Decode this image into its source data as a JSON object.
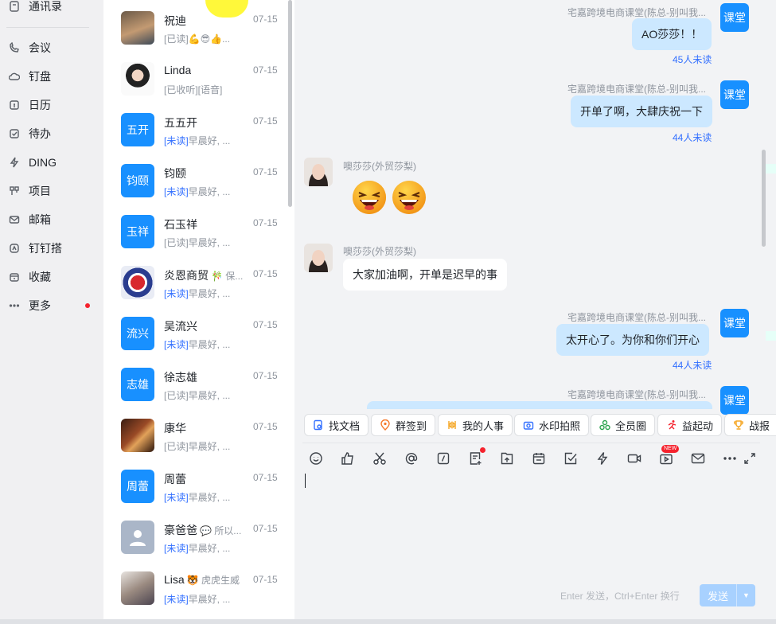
{
  "nav": {
    "items": [
      {
        "label": "通讯录",
        "icon": "contacts-icon"
      },
      {
        "label": "会议",
        "icon": "meeting-icon"
      },
      {
        "label": "钉盘",
        "icon": "cloud-drive-icon"
      },
      {
        "label": "日历",
        "icon": "calendar-icon"
      },
      {
        "label": "待办",
        "icon": "todo-icon"
      },
      {
        "label": "DING",
        "icon": "ding-icon"
      },
      {
        "label": "项目",
        "icon": "project-icon"
      },
      {
        "label": "邮箱",
        "icon": "mail-icon"
      },
      {
        "label": "钉钉搭",
        "icon": "dingda-icon"
      },
      {
        "label": "收藏",
        "icon": "favorites-icon"
      },
      {
        "label": "更多",
        "icon": "more-icon"
      }
    ]
  },
  "conversations": [
    {
      "name": "祝迪",
      "tag": "",
      "time": "07-15",
      "status": "[已读]",
      "preview": "💪😎👍...",
      "avatar": "photo"
    },
    {
      "name": "Linda",
      "tag": "",
      "time": "07-15",
      "status": "[已收听]",
      "preview": "[语音]",
      "avatar": "photo"
    },
    {
      "name": "五五开",
      "tag": "",
      "time": "07-15",
      "status": "[未读]",
      "preview": "早晨好, ...",
      "avatar_text": "五开"
    },
    {
      "name": "钧颐",
      "tag": "",
      "time": "07-15",
      "status": "[未读]",
      "preview": "早晨好, ...",
      "avatar_text": "钧颐"
    },
    {
      "name": "石玉祥",
      "tag": "",
      "time": "07-15",
      "status": "[已读]",
      "preview": "早晨好, ...",
      "avatar_text": "玉祥"
    },
    {
      "name": "炎恩商贸",
      "tag": "🎋 保...",
      "time": "07-15",
      "status": "[未读]",
      "preview": "早晨好, ...",
      "avatar": "logo"
    },
    {
      "name": "吴流兴",
      "tag": "",
      "time": "07-15",
      "status": "[未读]",
      "preview": "早晨好, ...",
      "avatar_text": "流兴"
    },
    {
      "name": "徐志雄",
      "tag": "",
      "time": "07-15",
      "status": "[已读]",
      "preview": "早晨好, ...",
      "avatar_text": "志雄"
    },
    {
      "name": "康华",
      "tag": "",
      "time": "07-15",
      "status": "[已读]",
      "preview": "早晨好, ...",
      "avatar": "photo"
    },
    {
      "name": "周蕾",
      "tag": "",
      "time": "07-15",
      "status": "[未读]",
      "preview": "早晨好, ...",
      "avatar_text": "周蕾"
    },
    {
      "name": "豪爸爸",
      "tag": "💬 所以...",
      "time": "07-15",
      "status": "[未读]",
      "preview": "早晨好, ...",
      "avatar": "default"
    },
    {
      "name": "Lisa",
      "tag": "🐯 虎虎生威",
      "time": "07-15",
      "status": "[未读]",
      "preview": "早晨好, ...",
      "avatar": "photo"
    }
  ],
  "chat": {
    "group_sender": "宅嘉跨境电商课堂(陈总-别叫我...",
    "group_avatar_text": "课堂",
    "other_sender": "噢莎莎(外贸莎梨)",
    "messages": [
      {
        "text": "AO莎莎！！",
        "unread": "45人未读"
      },
      {
        "text": "开单了啊，大肆庆祝一下",
        "unread": "44人未读"
      },
      {
        "emoji": "laughing-emoji"
      },
      {
        "text": "大家加油啊，开单是迟早的事"
      },
      {
        "text": "太开心了。为你和你们开心",
        "unread": "44人未读"
      }
    ]
  },
  "quick_tools": [
    "找文档",
    "群签到",
    "我的人事",
    "水印拍照",
    "全员圈",
    "益起动",
    "战报"
  ],
  "toolbar_icons": [
    "emoji-icon",
    "like-icon",
    "scissors-icon",
    "at-icon",
    "slash-icon",
    "doc-icon",
    "upload-icon",
    "calendar-icon",
    "check-icon",
    "ding-icon",
    "video-icon",
    "live-icon",
    "mail-icon",
    "more-icon",
    "expand-icon"
  ],
  "new_badge": "NEW",
  "input": {
    "hint": "Enter 发送，Ctrl+Enter 换行",
    "send_label": "发送",
    "send_arrow": "▼"
  }
}
